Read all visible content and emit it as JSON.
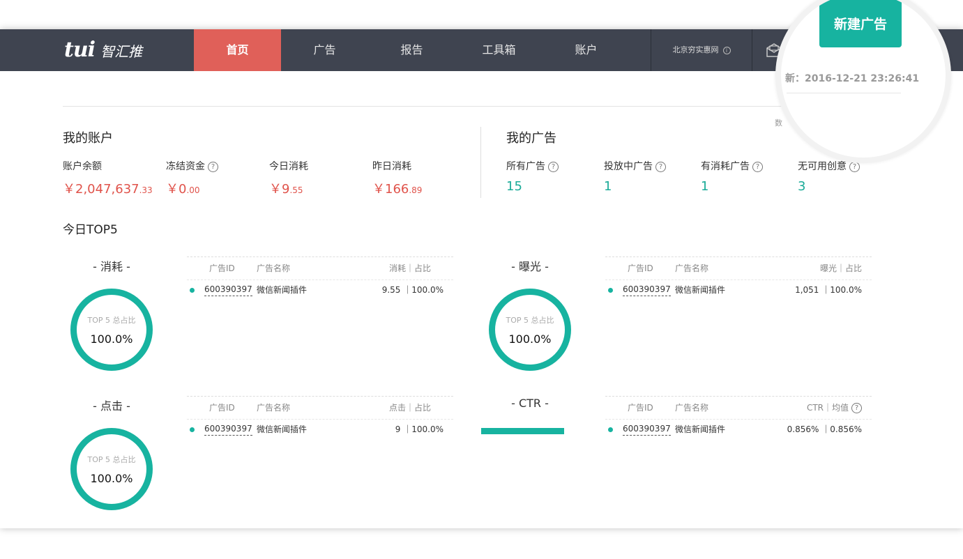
{
  "brand": {
    "mark": "tui",
    "name": "智汇推"
  },
  "nav": {
    "tabs": [
      {
        "label": "首页"
      },
      {
        "label": "广告"
      },
      {
        "label": "报告"
      },
      {
        "label": "工具箱"
      },
      {
        "label": "账户"
      }
    ],
    "account_name": "北京穷实惠网"
  },
  "header": {
    "new_ad_label": "新建广告",
    "updated_text": "新：2016-12-21 23:26:41",
    "partial_text": "数"
  },
  "my_account": {
    "title": "我的账户",
    "stats": [
      {
        "label": "账户余额",
        "currency": "￥",
        "main": "2,047,637",
        "decimal": ".33"
      },
      {
        "label": "冻结资金",
        "currency": "￥",
        "main": "0",
        "decimal": ".00"
      },
      {
        "label": "今日消耗",
        "currency": "￥",
        "main": "9",
        "decimal": ".55"
      },
      {
        "label": "昨日消耗",
        "currency": "￥",
        "main": "166",
        "decimal": ".89"
      }
    ]
  },
  "my_ads": {
    "title": "我的广告",
    "stats": [
      {
        "label": "所有广告",
        "value": "15"
      },
      {
        "label": "投放中广告",
        "value": "1"
      },
      {
        "label": "有消耗广告",
        "value": "1"
      },
      {
        "label": "无可用创意",
        "value": "3"
      }
    ]
  },
  "top5": {
    "title": "今日TOP5",
    "donut_label": "TOP 5 总占比",
    "col_id": "广告ID",
    "col_name": "广告名称",
    "panels": [
      {
        "title": "- 消耗 -",
        "donut_value": "100.0%",
        "share": 1.0,
        "col_metric": "消耗｜占比",
        "row": {
          "id": "600390397",
          "name": "微信新闻插件",
          "metric": "9.55 ｜100.0%"
        }
      },
      {
        "title": "- 曝光 -",
        "donut_value": "100.0%",
        "share": 1.0,
        "col_metric": "曝光｜占比",
        "row": {
          "id": "600390397",
          "name": "微信新闻插件",
          "metric": "1,051 ｜100.0%"
        }
      },
      {
        "title": "- 点击 -",
        "donut_value": "100.0%",
        "share": 1.0,
        "col_metric": "点击｜占比",
        "row": {
          "id": "600390397",
          "name": "微信新闻插件",
          "metric": "9 ｜100.0%"
        }
      },
      {
        "title": "- CTR -",
        "col_metric": "CTR｜均值",
        "row": {
          "id": "600390397",
          "name": "微信新闻插件",
          "metric": "0.856% ｜0.856%"
        }
      }
    ]
  },
  "colors": {
    "nav_bg": "#3f4450",
    "active_tab": "#e06059",
    "teal": "#17b3a0",
    "money_red": "#e0534b"
  }
}
